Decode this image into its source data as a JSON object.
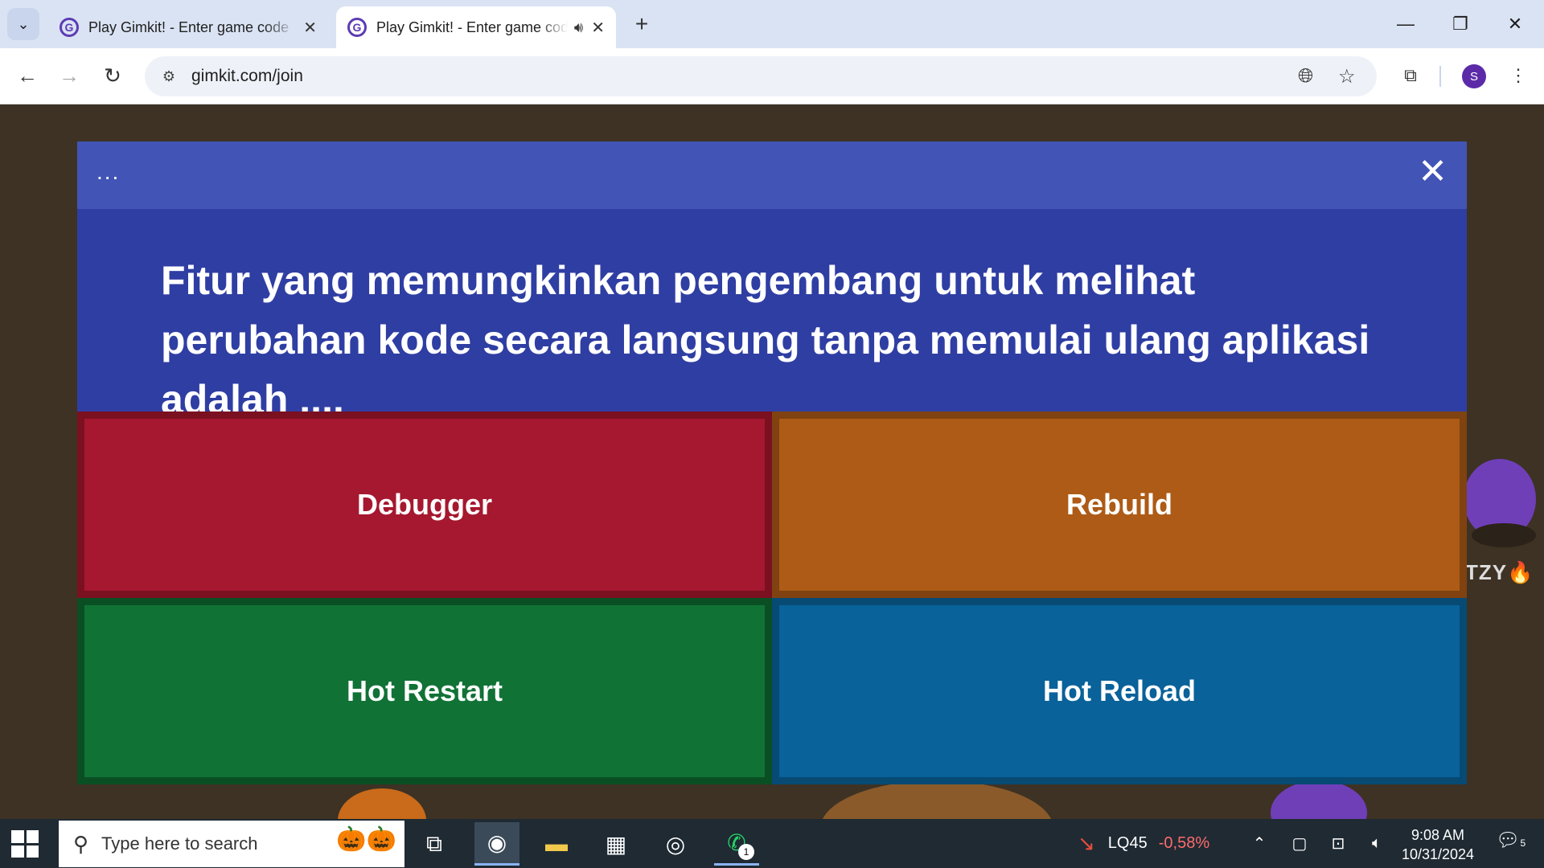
{
  "browser": {
    "tabs": [
      {
        "title": "Play Gimkit! - Enter game code",
        "active": false,
        "favicon": "G"
      },
      {
        "title": "Play Gimkit! - Enter game code",
        "active": true,
        "favicon": "G",
        "audio": true
      }
    ],
    "url": "gimkit.com/join",
    "profile_initial": "S"
  },
  "modal": {
    "menu_label": "...",
    "close_label": "✕",
    "question": "Fitur yang memungkinkan pengembang untuk melihat perubahan kode secara langsung tanpa memulai ulang aplikasi adalah ....",
    "answers": [
      {
        "label": "Debugger",
        "color": "#a5182f"
      },
      {
        "label": "Rebuild",
        "color": "#ad5b16"
      },
      {
        "label": "Hot Restart",
        "color": "#117236"
      },
      {
        "label": "Hot Reload",
        "color": "#09629a"
      }
    ]
  },
  "game": {
    "player_tag": "TZY🔥"
  },
  "taskbar": {
    "search_placeholder": "Type here to search",
    "whatsapp_badge": "1",
    "stock": {
      "ticker": "LQ45",
      "change": "-0,58%"
    },
    "time": "9:08 AM",
    "date": "10/31/2024",
    "notification_count": "5"
  }
}
